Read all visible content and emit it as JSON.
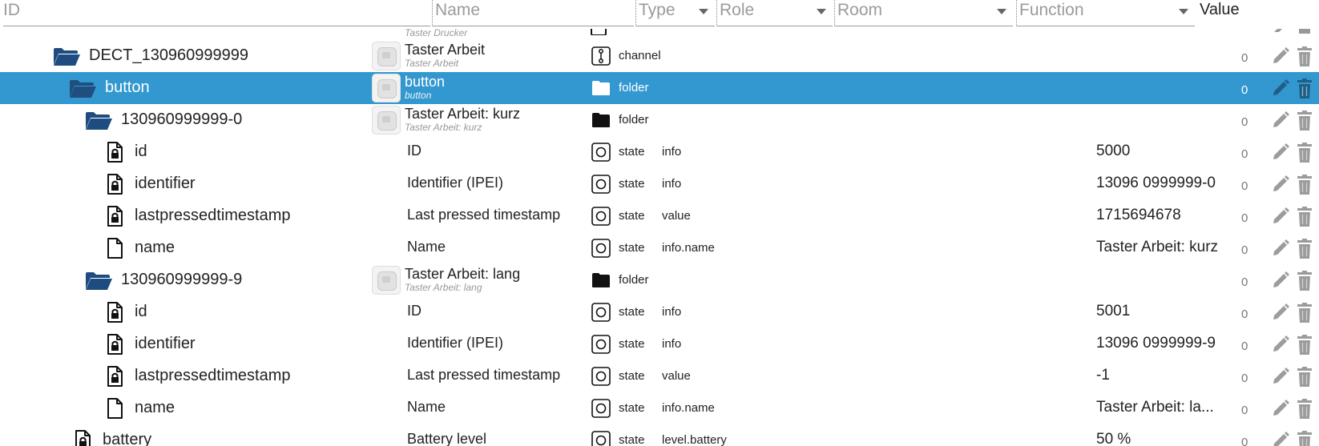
{
  "header": {
    "id_placeholder": "ID",
    "name_placeholder": "Name",
    "type_label": "Type",
    "role_label": "Role",
    "room_label": "Room",
    "function_label": "Function",
    "value_label": "Value"
  },
  "top_partial": {
    "name_sub": "Taster Drucker"
  },
  "rows": [
    {
      "id": "DECT_130960999999",
      "icon": "folder-open-icon",
      "name": "Taster Arbeit",
      "name_sub": "Taster Arbeit",
      "type_icon": "channel-icon",
      "type": "channel",
      "role": "",
      "value": "",
      "count": "0",
      "selected": false
    },
    {
      "id": "button",
      "icon": "folder-open-icon",
      "name": "button",
      "name_sub": "button",
      "type_icon": "folder-icon",
      "type": "folder",
      "role": "",
      "value": "",
      "count": "0",
      "selected": true
    },
    {
      "id": "130960999999-0",
      "icon": "folder-open-icon",
      "name": "Taster Arbeit: kurz",
      "name_sub": "Taster Arbeit: kurz",
      "type_icon": "folder-icon",
      "type": "folder",
      "role": "",
      "value": "",
      "count": "0",
      "selected": false
    },
    {
      "id": "id",
      "icon": "locked-file-icon",
      "name": "ID",
      "type_icon": "state-icon",
      "type": "state",
      "role": "info",
      "value": "5000",
      "count": "0",
      "selected": false
    },
    {
      "id": "identifier",
      "icon": "locked-file-icon",
      "name": "Identifier (IPEI)",
      "type_icon": "state-icon",
      "type": "state",
      "role": "info",
      "value": "13096 0999999-0",
      "count": "0",
      "selected": false
    },
    {
      "id": "lastpressedtimestamp",
      "icon": "locked-file-icon",
      "name": "Last pressed timestamp",
      "type_icon": "state-icon",
      "type": "state",
      "role": "value",
      "value": "1715694678",
      "count": "0",
      "selected": false
    },
    {
      "id": "name",
      "icon": "file-icon",
      "name": "Name",
      "type_icon": "state-icon",
      "type": "state",
      "role": "info.name",
      "value": "Taster Arbeit: kurz",
      "count": "0",
      "selected": false
    },
    {
      "id": "130960999999-9",
      "icon": "folder-open-icon",
      "name": "Taster Arbeit: lang",
      "name_sub": "Taster Arbeit: lang",
      "type_icon": "folder-icon",
      "type": "folder",
      "role": "",
      "value": "",
      "count": "0",
      "selected": false
    },
    {
      "id": "id",
      "icon": "locked-file-icon",
      "name": "ID",
      "type_icon": "state-icon",
      "type": "state",
      "role": "info",
      "value": "5001",
      "count": "0",
      "selected": false
    },
    {
      "id": "identifier",
      "icon": "locked-file-icon",
      "name": "Identifier (IPEI)",
      "type_icon": "state-icon",
      "type": "state",
      "role": "info",
      "value": "13096 0999999-9",
      "count": "0",
      "selected": false
    },
    {
      "id": "lastpressedtimestamp",
      "icon": "locked-file-icon",
      "name": "Last pressed timestamp",
      "type_icon": "state-icon",
      "type": "state",
      "role": "value",
      "value": "-1",
      "count": "0",
      "selected": false
    },
    {
      "id": "name",
      "icon": "file-icon",
      "name": "Name",
      "type_icon": "state-icon",
      "type": "state",
      "role": "info.name",
      "value": "Taster Arbeit: la...",
      "count": "0",
      "selected": false
    },
    {
      "id": "battery",
      "icon": "locked-file-icon",
      "name": "Battery level",
      "type_icon": "state-icon",
      "type": "state",
      "role": "level.battery",
      "value": "50 %",
      "count": "0",
      "selected": false
    }
  ]
}
